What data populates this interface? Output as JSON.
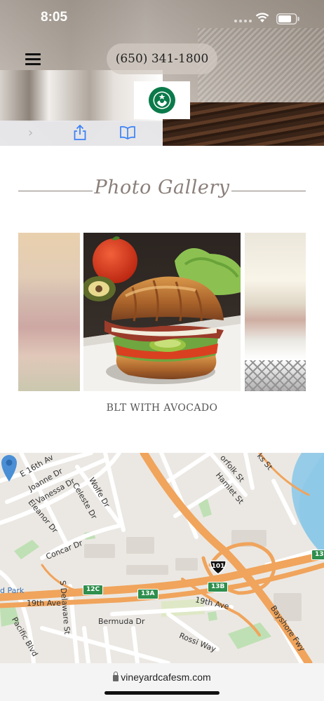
{
  "status_bar": {
    "time": "8:05"
  },
  "header": {
    "phone": "(650) 341-1800",
    "logo_name": "starbucks-logo"
  },
  "browser_toolbar": {
    "forward_icon": "chevron-right-icon",
    "share_icon": "share-icon",
    "bookmarks_icon": "book-icon"
  },
  "gallery": {
    "title": "Photo Gallery",
    "caption": "BLT WITH AVOCADO"
  },
  "map": {
    "streets": {
      "e16th": "E 16th Av",
      "joanne": "Joanne Dr",
      "vanessa": "Vanessa Dr",
      "celeste": "Celeste Dr",
      "wolfe": "Wolfe Dr",
      "eleanor": "Eleanor Dr",
      "norfolk": "orfolk St",
      "hamlet": "Hamlet St",
      "ks": "ks St",
      "concar": "Concar Dr",
      "sdelaware": "S Delaware St",
      "ave19w": "19th Ave",
      "ave19e": "19th Ave",
      "bermuda": "Bermuda Dr",
      "rossi": "Rossi Way",
      "pacific": "Pacific Blvd",
      "bayshore": "Bayshore Fwy",
      "dpark": "d Park"
    },
    "shields": {
      "s12c": "12C",
      "s13a": "13A",
      "s13b": "13B",
      "s13": "13",
      "s101": "101"
    }
  },
  "url_bar": {
    "domain": "vineyardcafesm.com"
  },
  "colors": {
    "accent_text": "#8a7f7a",
    "road_orange": "#f0a45c",
    "water": "#8ec9e8",
    "park": "#bfe0b4",
    "pin": "#4a8fd6"
  }
}
